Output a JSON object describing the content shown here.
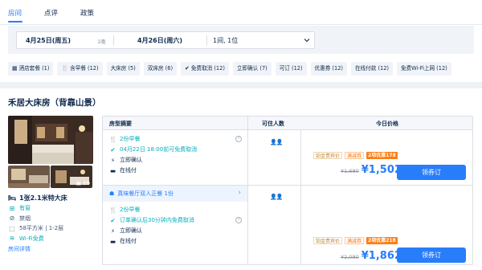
{
  "tabs": [
    "房间",
    "点评",
    "政策"
  ],
  "search": {
    "checkin": "4月25日(周五)",
    "nights": "1晚",
    "checkout": "4月26日(周六)",
    "room_guests": "1间, 1位"
  },
  "filters": [
    {
      "icon": "package-icon",
      "glyph": "▦",
      "label": "酒店套餐 (1)"
    },
    {
      "icon": "fork-knife-icon",
      "glyph": "🍴",
      "label": "含早餐 (12)"
    },
    {
      "icon": "",
      "glyph": "",
      "label": "大床房 (5)"
    },
    {
      "icon": "",
      "glyph": "",
      "label": "双床房 (6)"
    },
    {
      "icon": "check-circle-icon",
      "glyph": "✔",
      "label": "免费取消 (12)"
    },
    {
      "icon": "",
      "glyph": "",
      "label": "立即确认 (7)"
    },
    {
      "icon": "",
      "glyph": "",
      "label": "可订 (12)"
    },
    {
      "icon": "",
      "glyph": "",
      "label": "优惠券 (12)"
    },
    {
      "icon": "",
      "glyph": "",
      "label": "在线付款 (12)"
    },
    {
      "icon": "",
      "glyph": "",
      "label": "免费Wi-Fi上网 (12)"
    }
  ],
  "room": {
    "title": "禾居大床房（背靠山景）",
    "photo_count": "19",
    "bed": "1张2.1米特大床",
    "window": "有窗",
    "smoking": "禁烟",
    "area_floor": "58平方米 | 1-2层",
    "wifi": "Wi-Fi免费",
    "detail_link": "房间详情"
  },
  "table": {
    "headers": {
      "summary": "房型摘要",
      "guests": "可住人数",
      "price": "今日价格"
    },
    "rows": [
      {
        "features": [
          {
            "icon": "fork-knife-icon",
            "glyph": "🍴",
            "text": "2份早餐",
            "green": true,
            "info": true
          },
          {
            "icon": "check-circle-icon",
            "glyph": "✔",
            "text": "04月22日 18:00前可免费取消",
            "green": true,
            "info": false
          },
          {
            "icon": "bolt-icon",
            "glyph": "⚡",
            "text": "立即确认",
            "green": false,
            "info": false
          },
          {
            "icon": "card-icon",
            "glyph": "▬",
            "text": "在线付",
            "green": false,
            "info": false
          }
        ],
        "guests_icon": "two-person-icon",
        "tags": [
          "铂金贵宾价",
          "满减券",
          "2项优惠178"
        ],
        "old_price": "¥1,680",
        "price": "¥1,502",
        "button": "领券订"
      },
      {
        "deal": {
          "text": "真味餐厅双人正餐 1份",
          "icon": "cloche-icon",
          "glyph": "☗"
        },
        "features": [
          {
            "icon": "fork-knife-icon",
            "glyph": "🍴",
            "text": "2份早餐",
            "green": true,
            "info": false
          },
          {
            "icon": "check-circle-icon",
            "glyph": "✔",
            "text": "订单确认后30分钟内免费取消",
            "green": true,
            "info": true
          },
          {
            "icon": "bolt-icon",
            "glyph": "⚡",
            "text": "立即确认",
            "green": false,
            "info": false
          },
          {
            "icon": "card-icon",
            "glyph": "▬",
            "text": "在线付",
            "green": false,
            "info": false
          }
        ],
        "guests_icon": "two-person-icon",
        "tags": [
          "铂金贵宾价",
          "满减券",
          "2项优惠218"
        ],
        "old_price": "¥2,080",
        "price": "¥1,862",
        "button": "领券订"
      }
    ]
  },
  "colors": {
    "accent": "#287dfa",
    "green": "#06aebd",
    "orange": "#ff7d13"
  }
}
